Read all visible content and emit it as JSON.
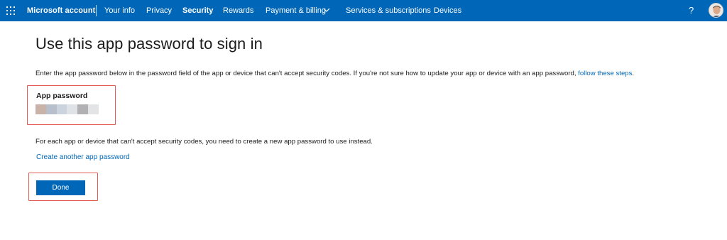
{
  "header": {
    "brand": "Microsoft account",
    "nav": [
      {
        "label": "Your info"
      },
      {
        "label": "Privacy"
      },
      {
        "label": "Security"
      },
      {
        "label": "Rewards"
      },
      {
        "label": "Payment & billing"
      },
      {
        "label": "Services & subscriptions"
      },
      {
        "label": "Devices"
      }
    ],
    "active_nav": "Security",
    "help_label": "?",
    "accent_color": "#0067b8"
  },
  "main": {
    "title": "Use this app password to sign in",
    "description": "Enter the app password below in the password field of the app or device that can't accept security codes. If you're not sure how to update your app or device with an app password, ",
    "description_link": "follow these steps",
    "description_end": ".",
    "password_label": "App password",
    "note": "For each app or device that can't accept security codes, you need to create a new app password to use instead.",
    "create_link": "Create another app password",
    "done_label": "Done",
    "highlight_color": "#e35b52"
  }
}
